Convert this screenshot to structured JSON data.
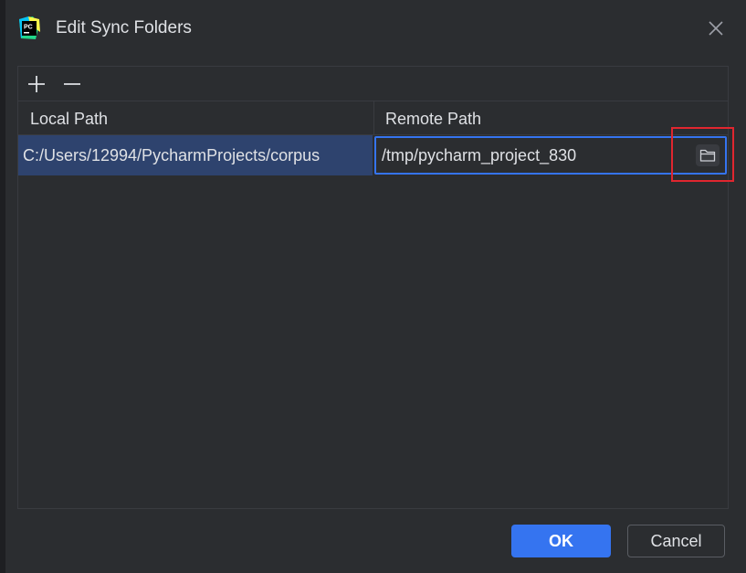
{
  "dialog": {
    "title": "Edit Sync Folders",
    "app_icon": "pycharm-logo-icon",
    "app_icon_text": "PC",
    "close_icon": "close-icon"
  },
  "toolbar": {
    "add_icon": "plus-icon",
    "remove_icon": "minus-icon"
  },
  "table": {
    "columns": [
      "Local Path",
      "Remote Path"
    ],
    "rows": [
      {
        "local_path": "C:/Users/12994/PycharmProjects/corpus",
        "remote_path": "/tmp/pycharm_project_830",
        "browse_icon": "folder-icon"
      }
    ]
  },
  "buttons": {
    "ok": "OK",
    "cancel": "Cancel"
  },
  "colors": {
    "background": "#2b2d30",
    "selection": "#2e436e",
    "accent": "#3574f0",
    "highlight": "#e0262f"
  }
}
